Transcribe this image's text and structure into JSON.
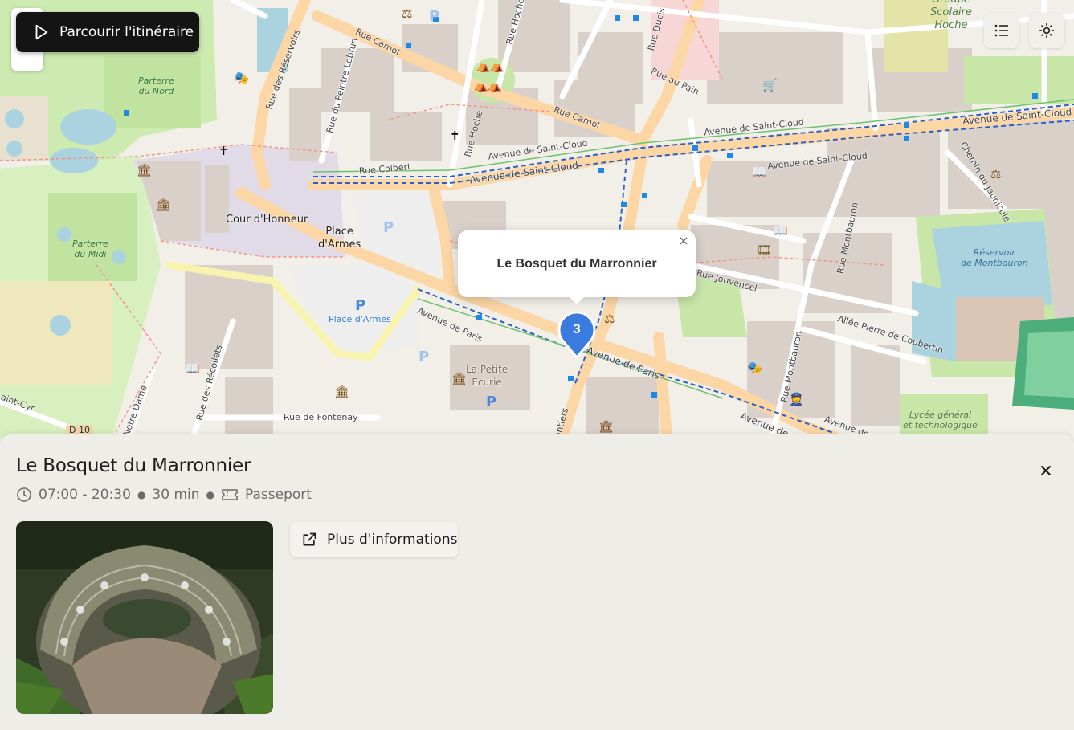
{
  "toolbar": {
    "tour_label": "Parcourir l'itinéraire",
    "list_icon": "list-icon",
    "theme_icon": "sun-icon"
  },
  "map": {
    "streets": {
      "rue_carnot_1": "Rue Carnot",
      "rue_carnot_2": "Rue Carnot",
      "rue_reservoirs": "Rue des Réservoirs",
      "rue_peintre_lebrun": "Rue du Peintre Lebrun",
      "rue_hoche": "Rue Hoche",
      "rue_hoche_2": "Rue Hoche",
      "rue_ducis": "Rue Ducis",
      "rue_au_pain": "Rue au Pain",
      "rue_colbert": "Rue Colbert",
      "av_saint_cloud_1": "Avenue de Saint-Cloud",
      "av_saint_cloud_2": "Avenue de Saint-Cloud",
      "av_saint_cloud_3": "Avenue de Saint-Cloud",
      "av_saint_cloud_4": "Avenue de Saint-Cloud",
      "av_saint_cloud_5": "Avenue de Saint-Cloud",
      "chemin_jaunicule": "Chemin du Jaunicule",
      "rue_montbauron_1": "Rue Montbauron",
      "rue_montbauron_2": "Rue Montbauron",
      "rue_jouvencel": "Rue Jouvencel",
      "allee_coubertin": "Allée Pierre de Coubertin",
      "av_paris_1": "Avenue de Paris",
      "av_paris_2": "Avenue de Paris",
      "av_paris_3": "Avenue de",
      "av_paris_4": "Avenue de",
      "rue_recollets": "Rue des Récollets",
      "rue_fontenay": "Rue de Fontenay",
      "notre_dame": "Notre Dame",
      "saint_cyr": "aint-Cyr",
      "d10": "D 10",
      "antiers": "antiers"
    },
    "places": {
      "cour_honneur": "Cour d'Honneur",
      "place_armes": "Place\nd'Armes",
      "place_armes_parking": "Place d'Armes",
      "la_petite_ecurie": "La Petite\nÉcurie",
      "parterre_nord": "Parterre\ndu Nord",
      "parterre_midi": "Parterre\ndu Midi",
      "reservoir": "Réservoir\nde Montbauron",
      "lycee": "Lycée général\net technologique",
      "groupe_scolaire": "Groupe\nScolaire\nHoche"
    },
    "parking_symbol": "P",
    "popup": {
      "title": "Le Bosquet du Marronnier",
      "close": "×"
    },
    "marker_number": "3",
    "marker_color": "#3a7be0"
  },
  "detail": {
    "title": "Le Bosquet du Marronnier",
    "hours": "07:00 - 20:30",
    "duration": "30 min",
    "ticket": "Passeport",
    "more_info_label": "Plus d'informations",
    "photo_alt": "photo-aerial-bosquet"
  }
}
